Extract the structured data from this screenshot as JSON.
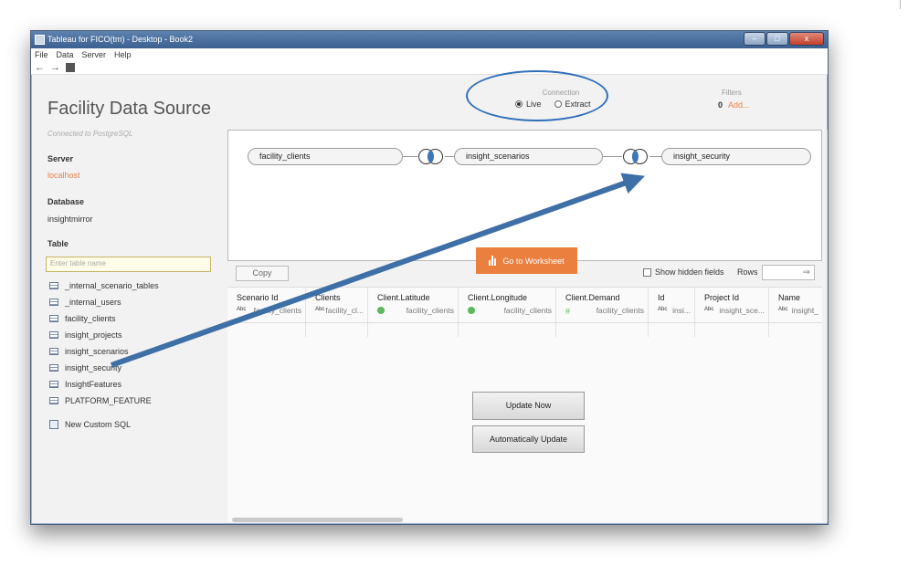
{
  "window": {
    "title": "Tableau for FICO(tm) - Desktop - Book2",
    "controls": [
      "–",
      "□",
      "x"
    ]
  },
  "menu": [
    "File",
    "Data",
    "Server",
    "Help"
  ],
  "toolbar": {
    "back": "←",
    "forward": "→"
  },
  "left_panel": {
    "title": "Facility Data Source",
    "connected": "Connected to PostgreSQL",
    "server_label": "Server",
    "server_value": "localhost",
    "database_label": "Database",
    "database_value": "insightmirror",
    "table_label": "Table",
    "table_search_placeholder": "Enter table name",
    "tables": [
      "_internal_scenario_tables",
      "_internal_users",
      "facility_clients",
      "insight_projects",
      "insight_scenarios",
      "insight_security",
      "InsightFeatures",
      "PLATFORM_FEATURE"
    ],
    "custom_sql": "New Custom SQL"
  },
  "connection": {
    "label": "Connection",
    "live": "Live",
    "extract": "Extract",
    "selected": "Live"
  },
  "filters": {
    "label": "Filters",
    "count": "0",
    "add": "Add..."
  },
  "join_canvas": {
    "tables": [
      "facility_clients",
      "insight_scenarios",
      "insight_security"
    ]
  },
  "goto_worksheet": "Go to Worksheet",
  "grid_toolbar": {
    "copy": "Copy",
    "show_hidden": "Show hidden fields",
    "rows_label": "Rows",
    "rows_icon": "⇒"
  },
  "columns": [
    {
      "name": "Scenario Id",
      "type": "Abc",
      "table": "facility_clients"
    },
    {
      "name": "Clients",
      "type": "Abc",
      "table": "facility_cl..."
    },
    {
      "name": "Client.Latitude",
      "type": "geo",
      "table": "facility_clients"
    },
    {
      "name": "Client.Longitude",
      "type": "geo",
      "table": "facility_clients"
    },
    {
      "name": "Client.Demand",
      "type": "#",
      "table": "facility_clients"
    },
    {
      "name": "Id",
      "type": "Abc",
      "table": "insi..."
    },
    {
      "name": "Project Id",
      "type": "Abc",
      "table": "insight_sce..."
    },
    {
      "name": "Name",
      "type": "Abc",
      "table": "insight_"
    }
  ],
  "buttons": {
    "update_now": "Update Now",
    "auto_update": "Automatically Update"
  },
  "colors": {
    "accent": "#ea7f3e",
    "title_bar": "#3b5f8f",
    "annotation": "#2f6fb8"
  }
}
